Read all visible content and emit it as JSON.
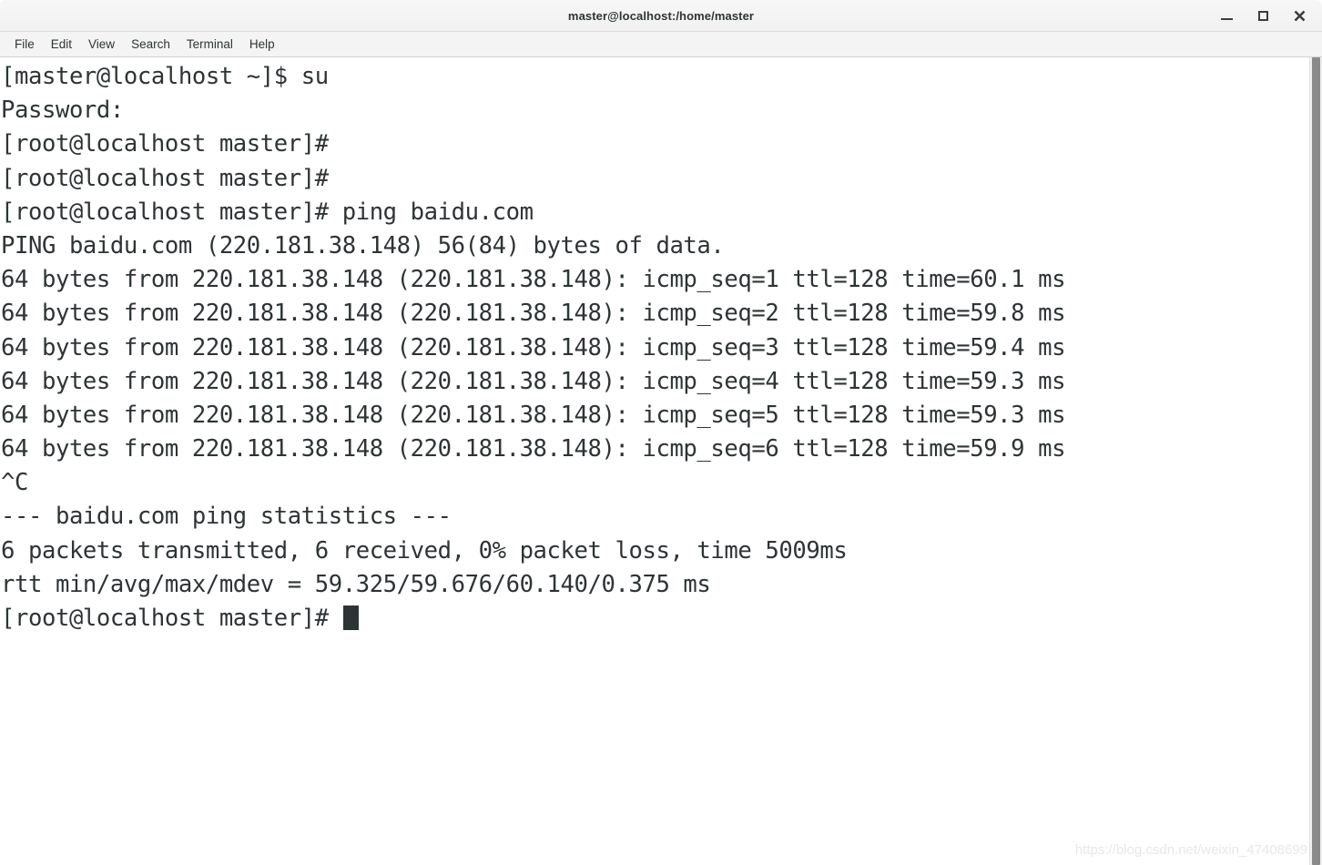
{
  "window": {
    "title": "master@localhost:/home/master",
    "controls": {
      "minimize_label": "–",
      "maximize_label": "□",
      "close_label": "✕"
    }
  },
  "menubar": {
    "items": [
      {
        "label": "File"
      },
      {
        "label": "Edit"
      },
      {
        "label": "View"
      },
      {
        "label": "Search"
      },
      {
        "label": "Terminal"
      },
      {
        "label": "Help"
      }
    ]
  },
  "terminal": {
    "foreground_color": "#2e3436",
    "background_color": "#ffffff",
    "lines": [
      "[master@localhost ~]$ su",
      "Password:",
      "[root@localhost master]#",
      "[root@localhost master]#",
      "[root@localhost master]# ping baidu.com",
      "PING baidu.com (220.181.38.148) 56(84) bytes of data.",
      "64 bytes from 220.181.38.148 (220.181.38.148): icmp_seq=1 ttl=128 time=60.1 ms",
      "64 bytes from 220.181.38.148 (220.181.38.148): icmp_seq=2 ttl=128 time=59.8 ms",
      "64 bytes from 220.181.38.148 (220.181.38.148): icmp_seq=3 ttl=128 time=59.4 ms",
      "64 bytes from 220.181.38.148 (220.181.38.148): icmp_seq=4 ttl=128 time=59.3 ms",
      "64 bytes from 220.181.38.148 (220.181.38.148): icmp_seq=5 ttl=128 time=59.3 ms",
      "64 bytes from 220.181.38.148 (220.181.38.148): icmp_seq=6 ttl=128 time=59.9 ms",
      "^C",
      "--- baidu.com ping statistics ---",
      "6 packets transmitted, 6 received, 0% packet loss, time 5009ms",
      "rtt min/avg/max/mdev = 59.325/59.676/60.140/0.375 ms"
    ],
    "prompt": "[root@localhost master]# "
  },
  "watermark": {
    "text": "https://blog.csdn.net/weixin_47408699"
  }
}
